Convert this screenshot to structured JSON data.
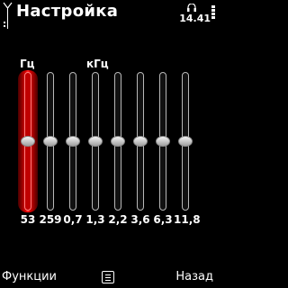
{
  "header": {
    "title": "Настройка",
    "time": "14.41"
  },
  "units": {
    "hz": "Гц",
    "khz": "кГц"
  },
  "bands": [
    {
      "label": "53",
      "level": 0,
      "active": true
    },
    {
      "label": "259",
      "level": 0,
      "active": false
    },
    {
      "label": "0,7",
      "level": 0,
      "active": false
    },
    {
      "label": "1,3",
      "level": 0,
      "active": false
    },
    {
      "label": "2,2",
      "level": 0,
      "active": false
    },
    {
      "label": "3,6",
      "level": 0,
      "active": false
    },
    {
      "label": "6,3",
      "level": 0,
      "active": false
    },
    {
      "label": "11,8",
      "level": 0,
      "active": false
    }
  ],
  "softkeys": {
    "left": "Функции",
    "right": "Назад",
    "middle_icon": "menu-icon"
  },
  "colors": {
    "accent": "#e00000",
    "background": "#000000",
    "text": "#ffffff"
  }
}
